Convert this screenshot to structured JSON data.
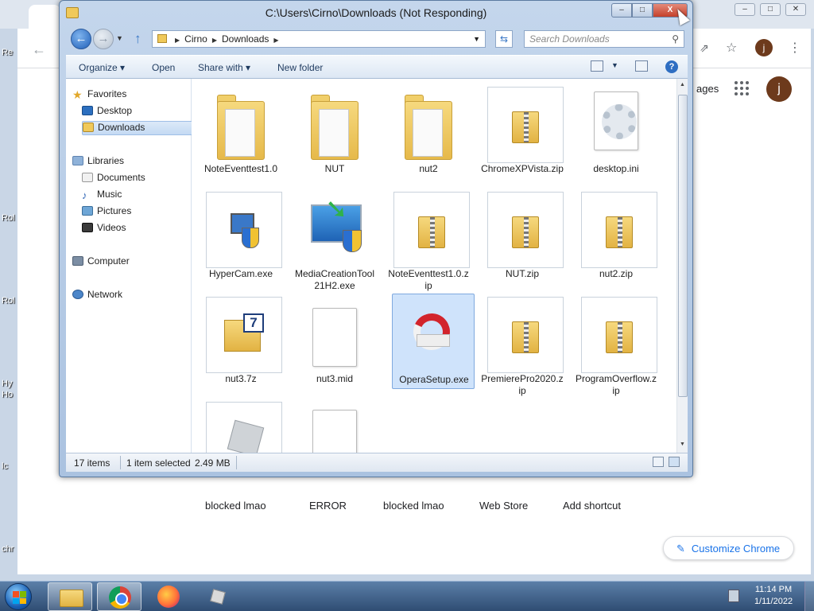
{
  "explorer": {
    "title": "C:\\Users\\Cirno\\Downloads (Not Responding)",
    "window_buttons": {
      "minimize": "–",
      "maximize": "□",
      "close": "X"
    },
    "address": {
      "segments": [
        "Cirno",
        "Downloads"
      ]
    },
    "search_placeholder": "Search Downloads",
    "toolbar": {
      "organize": "Organize ▾",
      "open": "Open",
      "share_with": "Share with ▾",
      "new_folder": "New folder",
      "help": "?"
    },
    "nav": {
      "favorites": "Favorites",
      "desktop": "Desktop",
      "downloads": "Downloads",
      "libraries": "Libraries",
      "documents": "Documents",
      "music": "Music",
      "pictures": "Pictures",
      "videos": "Videos",
      "computer": "Computer",
      "network": "Network"
    },
    "files": [
      {
        "name": "NoteEventtest1.0",
        "type": "folder"
      },
      {
        "name": "NUT",
        "type": "folder"
      },
      {
        "name": "nut2",
        "type": "folder"
      },
      {
        "name": "ChromeXPVista.zip",
        "type": "zip"
      },
      {
        "name": "desktop.ini",
        "type": "ini"
      },
      {
        "name": "HyperCam.exe",
        "type": "exe"
      },
      {
        "name": "MediaCreationTool21H2.exe",
        "type": "exe"
      },
      {
        "name": "NoteEventtest1.0.zip",
        "type": "zip"
      },
      {
        "name": "NUT.zip",
        "type": "zip"
      },
      {
        "name": "nut2.zip",
        "type": "zip"
      },
      {
        "name": "nut3.7z",
        "type": "7z"
      },
      {
        "name": "nut3.mid",
        "type": "doc"
      },
      {
        "name": "OperaSetup.exe",
        "type": "exe"
      },
      {
        "name": "PremierePro2020.zip",
        "type": "zip"
      },
      {
        "name": "ProgramOverflow.zip",
        "type": "zip"
      },
      {
        "name": "",
        "type": "roblox"
      },
      {
        "name": "",
        "type": "doc"
      }
    ],
    "status": {
      "count": "17 items",
      "selected": "1 item selected",
      "size": "2.49 MB"
    }
  },
  "chrome": {
    "images_link": "ages",
    "profile_initial": "j",
    "shortcuts": [
      "blocked lmao",
      "ERROR",
      "blocked lmao",
      "Web Store",
      "Add shortcut"
    ],
    "customize": "Customize Chrome"
  },
  "desktop_labels": [
    "Re",
    "Rol",
    "Rol",
    "Hy",
    "Ho",
    "lc",
    "chr"
  ],
  "taskbar": {
    "time": "11:14 PM",
    "date": "1/11/2022"
  }
}
